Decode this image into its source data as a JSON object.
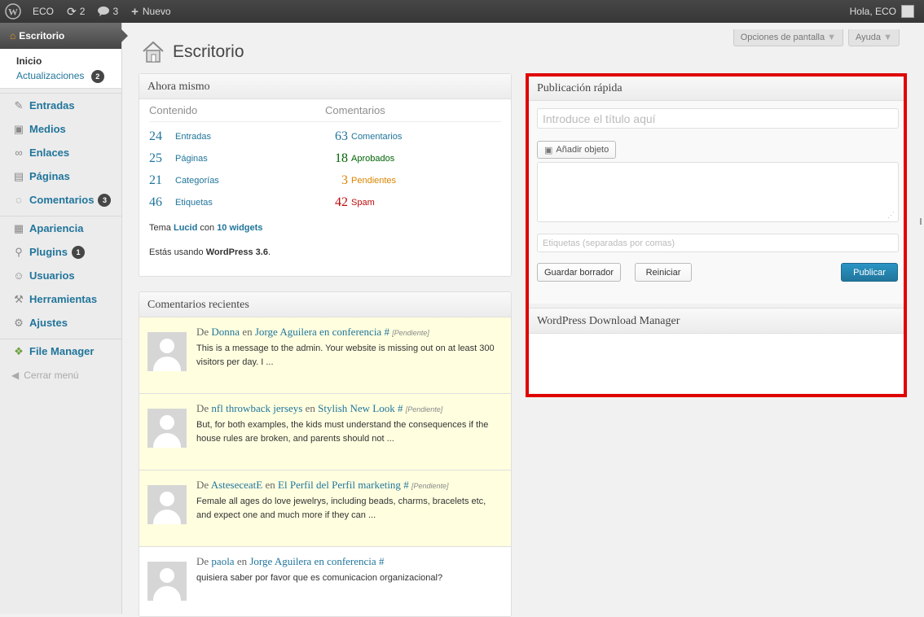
{
  "adminbar": {
    "site": "ECO",
    "updates": "2",
    "comments": "3",
    "new": "Nuevo",
    "greeting": "Hola, ECO"
  },
  "menu": {
    "current": "Escritorio",
    "sub": [
      "Inicio",
      "Actualizaciones"
    ],
    "updates_badge": "2",
    "items": [
      {
        "label": "Entradas",
        "icon": "pin-icon"
      },
      {
        "label": "Medios",
        "icon": "media-icon"
      },
      {
        "label": "Enlaces",
        "icon": "link-icon"
      },
      {
        "label": "Páginas",
        "icon": "page-icon"
      },
      {
        "label": "Comentarios",
        "icon": "comment-icon",
        "badge": "3"
      },
      {
        "label": "Apariencia",
        "icon": "appearance-icon"
      },
      {
        "label": "Plugins",
        "icon": "plugin-icon",
        "badge": "1"
      },
      {
        "label": "Usuarios",
        "icon": "users-icon"
      },
      {
        "label": "Herramientas",
        "icon": "tools-icon"
      },
      {
        "label": "Ajustes",
        "icon": "settings-icon"
      },
      {
        "label": "File Manager",
        "icon": "file-manager-icon"
      }
    ],
    "collapse": "Cerrar menú"
  },
  "header": {
    "title": "Escritorio",
    "screen_options": "Opciones de pantalla",
    "help": "Ayuda"
  },
  "right_now": {
    "title": "Ahora mismo",
    "content_head": "Contenido",
    "comments_head": "Comentarios",
    "content": [
      {
        "num": "24",
        "label": "Entradas"
      },
      {
        "num": "25",
        "label": "Páginas"
      },
      {
        "num": "21",
        "label": "Categorías"
      },
      {
        "num": "46",
        "label": "Etiquetas"
      }
    ],
    "comments": [
      {
        "num": "63",
        "label": "Comentarios"
      },
      {
        "num": "18",
        "label": "Aprobados"
      },
      {
        "num": "3",
        "label": "Pendientes"
      },
      {
        "num": "42",
        "label": "Spam"
      }
    ],
    "theme_prefix": "Tema",
    "theme": "Lucid",
    "theme_with": "con",
    "widgets": "10 widgets",
    "version_prefix": "Estás usando",
    "version": "WordPress 3.6",
    "version_suffix": "."
  },
  "recent_comments": {
    "title": "Comentarios recientes",
    "by": "De",
    "on": "en",
    "hash": "#",
    "items": [
      {
        "author": "Donna",
        "post": "Jorge Aguilera en conferencia",
        "status": "[Pendiente]",
        "text": "This is a message to the admin. Your website is missing out on at least 300 visitors per day. I ..."
      },
      {
        "author": "nfl throwback jerseys",
        "post": "Stylish New Look",
        "status": "[Pendiente]",
        "text": "But, for both examples, the kids must understand the consequences if the house rules are broken, and parents should not ..."
      },
      {
        "author": "AsteseceatE",
        "post": "El Perfil del Perfil marketing",
        "status": "[Pendiente]",
        "text": "Female all ages do love jewelrys, including beads, charms, bracelets etc, and expect one and much more if they can ..."
      },
      {
        "author": "paola",
        "post": "Jorge Aguilera en conferencia",
        "status": "",
        "text": "quisiera saber por favor que es comunicacion organizacional?"
      }
    ]
  },
  "quick_press": {
    "title": "Publicación rápida",
    "title_placeholder": "Introduce el título aquí",
    "add_media": "Añadir objeto",
    "tags_placeholder": "Etiquetas (separadas por comas)",
    "save_draft": "Guardar borrador",
    "reset": "Reiniciar",
    "publish": "Publicar"
  },
  "download_manager": {
    "title": "WordPress Download Manager"
  },
  "colors": {
    "link": "#21759b",
    "approved": "#006505",
    "pending": "#d98500",
    "spam": "#bc0b0b",
    "highlight_box": "#e00000",
    "publish_button": "#21759b"
  }
}
